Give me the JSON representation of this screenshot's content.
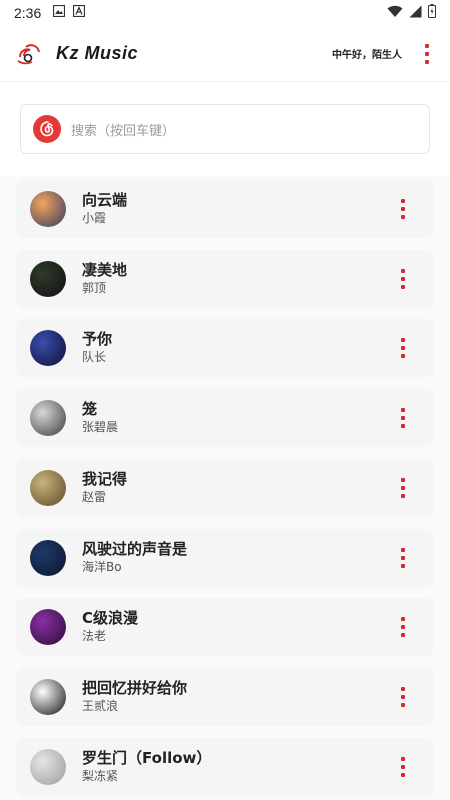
{
  "status_bar": {
    "time": "2:36",
    "icons": [
      "image-icon",
      "a-icon",
      "wifi-icon",
      "signal-icon",
      "battery-icon"
    ]
  },
  "app_bar": {
    "title": "Kz Music",
    "greeting": "中午好，陌生人",
    "logo_icon": "music-logo-icon",
    "menu_icon": "more-vertical-icon",
    "accent": "#d32f2f"
  },
  "search": {
    "placeholder": "搜索（按回车键）",
    "icon": "netease-logo-icon"
  },
  "songs": [
    {
      "title": "向云端",
      "artist": "小霞",
      "cover": [
        "#f4a460",
        "#2f3b5e"
      ]
    },
    {
      "title": "凄美地",
      "artist": "郭顶",
      "cover": [
        "#2e3a2a",
        "#111111"
      ]
    },
    {
      "title": "予你",
      "artist": "队长",
      "cover": [
        "#3b4fa8",
        "#0b0f3a"
      ]
    },
    {
      "title": "笼",
      "artist": "张碧晨",
      "cover": [
        "#d8d8d8",
        "#3a3a3a"
      ]
    },
    {
      "title": "我记得",
      "artist": "赵雷",
      "cover": [
        "#c9b27a",
        "#5a4a2a"
      ]
    },
    {
      "title": "风驶过的声音是",
      "artist": "海洋Bo",
      "cover": [
        "#1f3a66",
        "#0a1530"
      ]
    },
    {
      "title": "C级浪漫",
      "artist": "法老",
      "cover": [
        "#8a2fa0",
        "#2a0d3a"
      ]
    },
    {
      "title": "把回忆拼好给你",
      "artist": "王贰浪",
      "cover": [
        "#ffffff",
        "#111111"
      ]
    },
    {
      "title": "罗生门（Follow）",
      "artist": "梨冻紧",
      "cover": [
        "#e6e6e6",
        "#9a9a9a"
      ]
    }
  ]
}
